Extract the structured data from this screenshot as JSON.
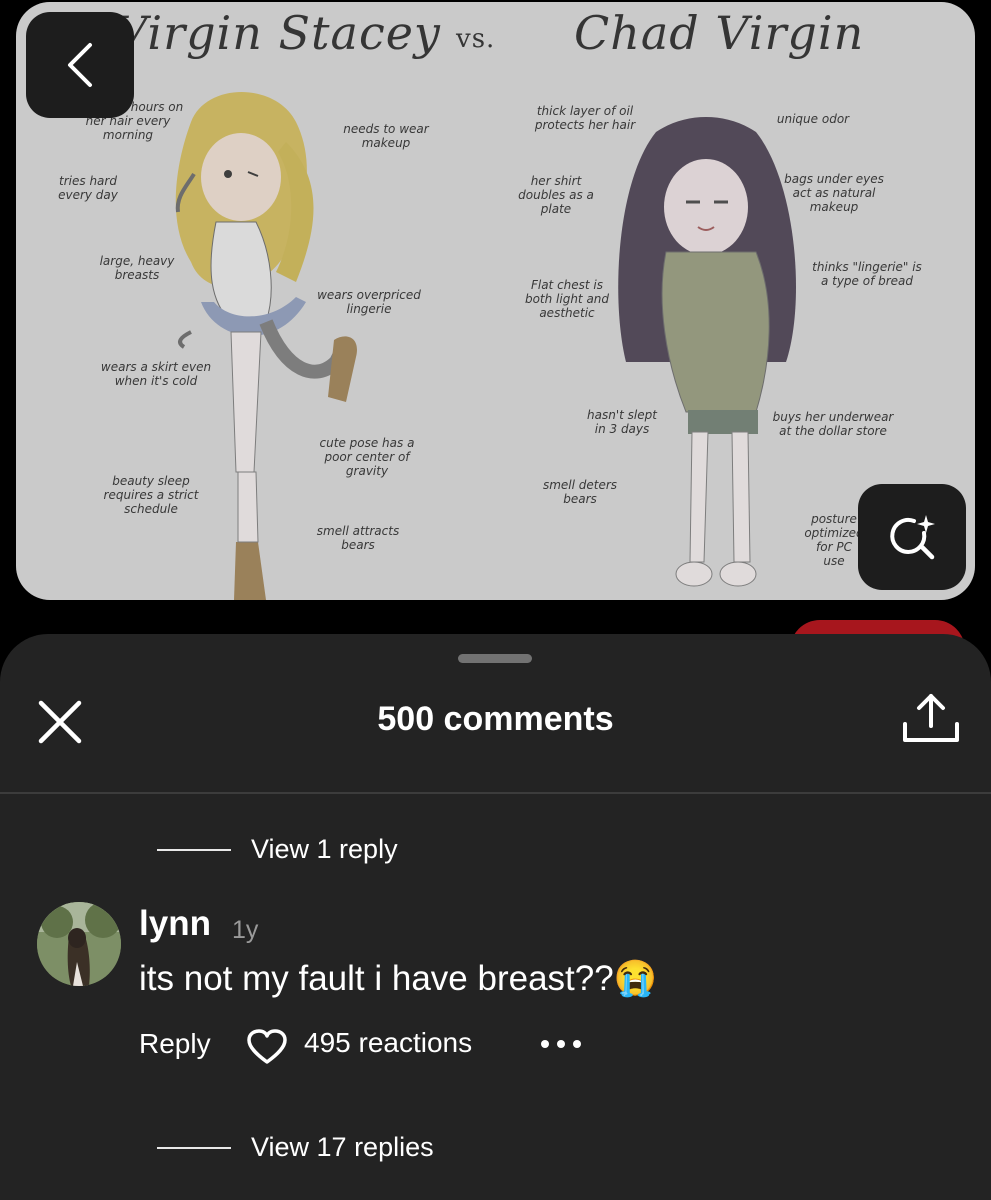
{
  "pin": {
    "title_left": "Virgin Stacey",
    "title_vs": "vs.",
    "title_right": "Chad Virgin",
    "notes_left": [
      "spends 3 hours on her hair every morning",
      "needs to wear makeup",
      "tries hard every day",
      "large, heavy breasts",
      "wears overpriced lingerie",
      "wears a skirt even when it's cold",
      "cute pose has a poor center of gravity",
      "beauty sleep requires a strict schedule",
      "smell attracts bears"
    ],
    "notes_right": [
      "thick layer of oil protects her hair",
      "unique odor",
      "her shirt doubles as a plate",
      "bags under eyes act as natural makeup",
      "thinks \"lingerie\" is a type of bread",
      "Flat chest is both light and aesthetic",
      "hasn't slept in 3 days",
      "buys her underwear at the dollar store",
      "smell deters bears",
      "posture optimized for PC use"
    ],
    "back_icon": "chevron-left-icon",
    "lens_icon": "visual-search-icon"
  },
  "sheet": {
    "title": "500 comments",
    "close_icon": "close-icon",
    "share_icon": "share-icon",
    "view_reply_top": "View 1 reply",
    "view_reply_bottom": "View 17 replies"
  },
  "comment": {
    "username": "lynn",
    "time": "1y",
    "text": "its not my fault i have breast??😭",
    "reply_label": "Reply",
    "reactions": "495 reactions",
    "heart_icon": "heart-icon",
    "more_icon": "more-options-icon"
  },
  "colors": {
    "sheet_bg": "#232323",
    "accent_red": "#a7161d",
    "image_bg": "#dcdcdc"
  }
}
